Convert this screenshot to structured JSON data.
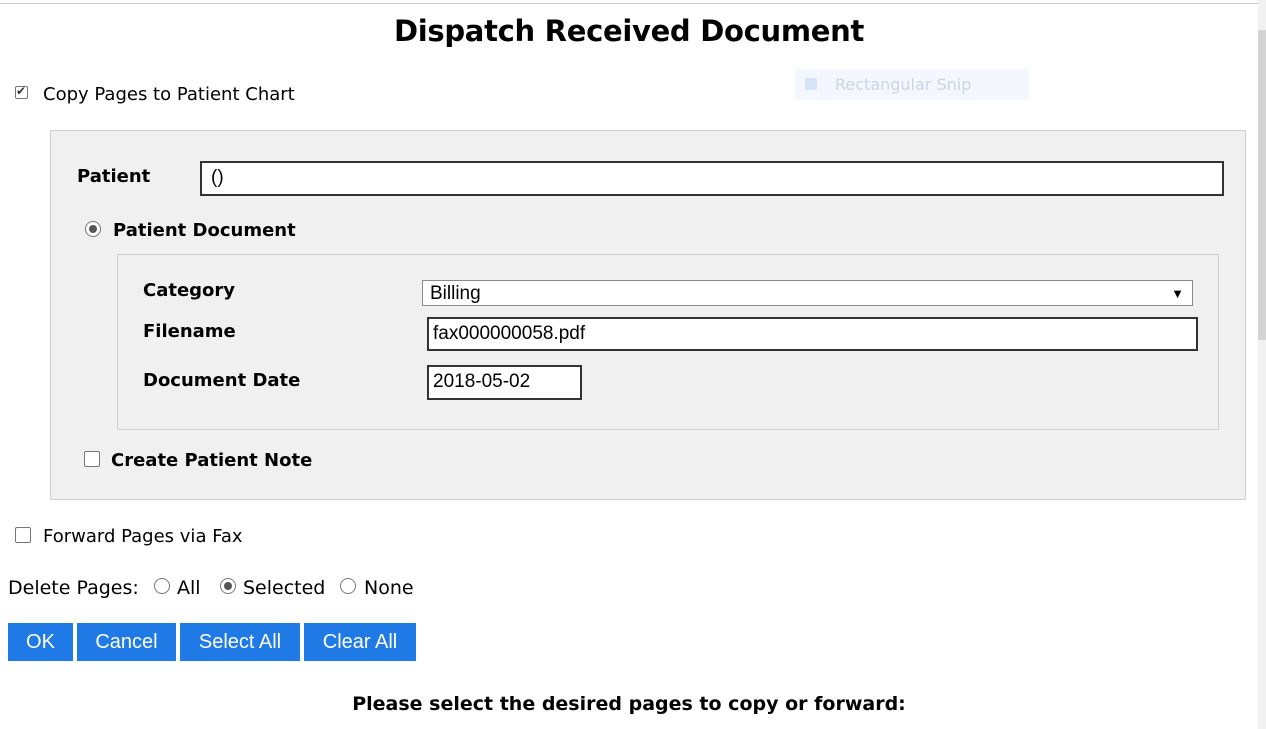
{
  "page": {
    "title": "Dispatch Received Document",
    "footer_text": "Please select the desired pages to copy or forward:"
  },
  "overlay": {
    "snip_label": "Rectangular Snip"
  },
  "copy_section": {
    "label": "Copy Pages to Patient Chart",
    "checked": true,
    "patient_label": "Patient",
    "patient_value": "()",
    "patient_document_label": "Patient Document",
    "patient_document_selected": true,
    "category_label": "Category",
    "category_value": "Billing",
    "filename_label": "Filename",
    "filename_value": "fax000000058.pdf",
    "document_date_label": "Document Date",
    "document_date_value": "2018-05-02",
    "create_note_label": "Create Patient Note",
    "create_note_checked": false
  },
  "forward_section": {
    "label": "Forward Pages via Fax",
    "checked": false
  },
  "delete_pages": {
    "label": "Delete Pages:",
    "options": [
      {
        "label": "All",
        "selected": false
      },
      {
        "label": "Selected",
        "selected": true
      },
      {
        "label": "None",
        "selected": false
      }
    ]
  },
  "buttons": {
    "ok": "OK",
    "cancel": "Cancel",
    "select_all": "Select All",
    "clear_all": "Clear All"
  },
  "colors": {
    "button_bg": "#1f7ae6",
    "panel_bg": "#f0f0f0"
  }
}
